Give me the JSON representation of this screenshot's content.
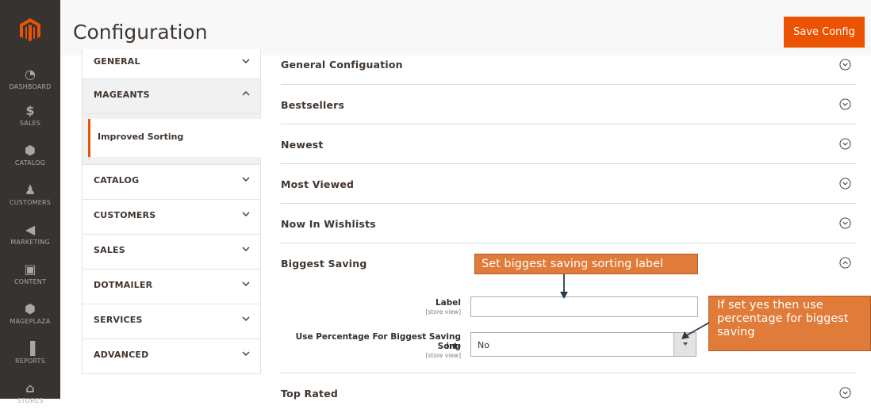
{
  "admin_nav": [
    {
      "label": "DASHBOARD",
      "icon": "dashboard-icon"
    },
    {
      "label": "SALES",
      "icon": "dollar-icon"
    },
    {
      "label": "CATALOG",
      "icon": "box-icon"
    },
    {
      "label": "CUSTOMERS",
      "icon": "person-icon"
    },
    {
      "label": "MARKETING",
      "icon": "megaphone-icon"
    },
    {
      "label": "CONTENT",
      "icon": "layout-icon"
    },
    {
      "label": "MAGEPLAZA",
      "icon": "box-icon"
    },
    {
      "label": "REPORTS",
      "icon": "bar-chart-icon"
    },
    {
      "label": "STORES",
      "icon": "store-icon"
    }
  ],
  "header": {
    "title": "Configuration",
    "save_label": "Save Config"
  },
  "tabs": {
    "general": "GENERAL",
    "mageants": "MAGEANTS",
    "improved_sorting": "Improved Sorting",
    "catalog": "CATALOG",
    "customers": "CUSTOMERS",
    "sales": "SALES",
    "dotmailer": "DOTMAILER",
    "services": "SERVICES",
    "advanced": "ADVANCED"
  },
  "sections": {
    "general": "General Configuation",
    "bestsellers": "Bestsellers",
    "newest": "Newest",
    "most_viewed": "Most Viewed",
    "wishlists": "Now In Wishlists",
    "biggest_saving": "Biggest Saving",
    "top_rated": "Top Rated"
  },
  "fields": {
    "label": {
      "label": "Label",
      "scope": "[store view]",
      "value": ""
    },
    "use_percentage": {
      "label_line1": "Use Percentage For Biggest Saving Sort-",
      "label_line2": "ing",
      "scope": "[store view]",
      "value": "No"
    }
  },
  "callouts": {
    "label_callout": "Set biggest saving sorting label",
    "percentage_callout_1": "If set yes then use",
    "percentage_callout_2": "percentage for biggest",
    "percentage_callout_3": "saving"
  },
  "colors": {
    "accent": "#eb5202",
    "sidebar": "#373330",
    "callout": "#e07b39"
  }
}
